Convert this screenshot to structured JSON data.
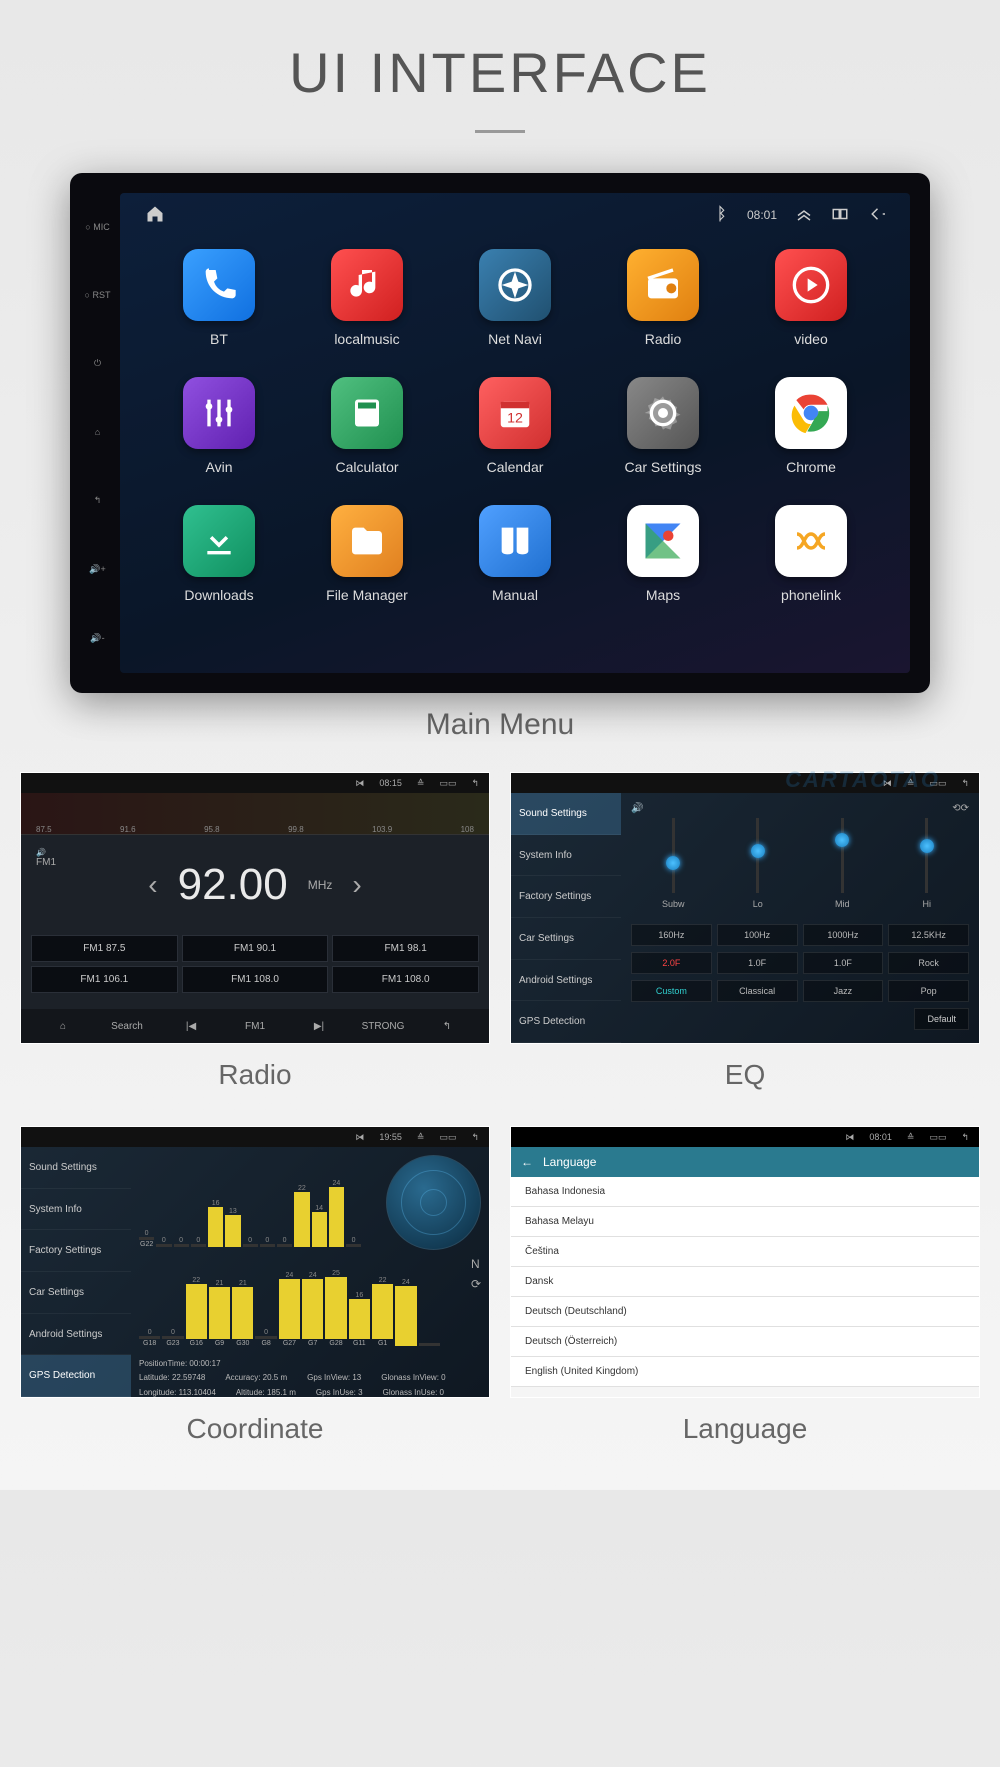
{
  "page": {
    "title": "UI INTERFACE"
  },
  "main": {
    "caption": "Main Menu",
    "status": {
      "time": "08:01"
    },
    "side_labels": {
      "mic": "MIC",
      "rst": "RST"
    },
    "apps": [
      {
        "label": "BT",
        "bg": "linear-gradient(135deg,#3aa0ff,#1070e0)",
        "icon": "phone"
      },
      {
        "label": "localmusic",
        "bg": "linear-gradient(135deg,#ff5050,#d02020)",
        "icon": "music"
      },
      {
        "label": "Net Navi",
        "bg": "linear-gradient(135deg,#3a80b0,#205070)",
        "icon": "compass"
      },
      {
        "label": "Radio",
        "bg": "linear-gradient(135deg,#ffb030,#e08010)",
        "icon": "radio"
      },
      {
        "label": "video",
        "bg": "linear-gradient(135deg,#ff5050,#d02020)",
        "icon": "play"
      },
      {
        "label": "Avin",
        "bg": "linear-gradient(135deg,#9050e0,#6020b0)",
        "icon": "sliders"
      },
      {
        "label": "Calculator",
        "bg": "linear-gradient(135deg,#50c080,#209050)",
        "icon": "calc"
      },
      {
        "label": "Calendar",
        "bg": "linear-gradient(135deg,#ff6060,#d03030)",
        "icon": "calendar"
      },
      {
        "label": "Car Settings",
        "bg": "linear-gradient(135deg,#888,#555)",
        "icon": "gear"
      },
      {
        "label": "Chrome",
        "bg": "#fff",
        "icon": "chrome"
      },
      {
        "label": "Downloads",
        "bg": "linear-gradient(135deg,#30c090,#109060)",
        "icon": "download"
      },
      {
        "label": "File Manager",
        "bg": "linear-gradient(135deg,#ffb040,#e08020)",
        "icon": "folder"
      },
      {
        "label": "Manual",
        "bg": "linear-gradient(135deg,#50a0ff,#2070d0)",
        "icon": "book"
      },
      {
        "label": "Maps",
        "bg": "#fff",
        "icon": "maps"
      },
      {
        "label": "phonelink",
        "bg": "#fff",
        "icon": "link"
      }
    ]
  },
  "radio": {
    "caption": "Radio",
    "status_time": "08:15",
    "band": "FM1",
    "dial": [
      "87.5",
      "91.6",
      "95.8",
      "99.8",
      "103.9",
      "108"
    ],
    "frequency": "92.00",
    "unit": "MHz",
    "presets": [
      "FM1 87.5",
      "FM1 90.1",
      "FM1 98.1",
      "FM1 106.1",
      "FM1 108.0",
      "FM1 108.0"
    ],
    "bottom": {
      "search": "Search",
      "band_btn": "FM1",
      "strong": "STRONG"
    }
  },
  "eq": {
    "caption": "EQ",
    "side": [
      "Sound Settings",
      "System Info",
      "Factory Settings",
      "Car Settings",
      "Android Settings",
      "GPS Detection"
    ],
    "active_side": 0,
    "sliders": [
      {
        "label": "Subw",
        "pos": 50
      },
      {
        "label": "Lo",
        "pos": 35
      },
      {
        "label": "Mid",
        "pos": 20
      },
      {
        "label": "Hi",
        "pos": 28
      }
    ],
    "row1": [
      "160Hz",
      "100Hz",
      "1000Hz",
      "12.5KHz"
    ],
    "row2": [
      "2.0F",
      "1.0F",
      "1.0F",
      "Rock"
    ],
    "row3": [
      "Custom",
      "Classical",
      "Jazz",
      "Pop"
    ],
    "default_btn": "Default"
  },
  "coord": {
    "caption": "Coordinate",
    "status_time": "19:55",
    "side": [
      "Sound Settings",
      "System Info",
      "Factory Settings",
      "Car Settings",
      "Android Settings",
      "GPS Detection"
    ],
    "active_side": 5,
    "sat_nums": [
      "0",
      "0",
      "0",
      "0",
      "16",
      "13",
      "0",
      "0",
      "0",
      "22",
      "14",
      "24",
      "0"
    ],
    "sat_ids": [
      "G22",
      "",
      "",
      "",
      "",
      "",
      "",
      "",
      "",
      "",
      "",
      "",
      ""
    ],
    "sat_nums2": [
      "0",
      "0",
      "22",
      "21",
      "21",
      "0",
      "24",
      "24",
      "25",
      "16",
      "22",
      "24",
      ""
    ],
    "sat_ids2": [
      "G18",
      "G23",
      "G16",
      "G9",
      "G30",
      "G8",
      "G27",
      "G7",
      "G28",
      "G11",
      "G1",
      ""
    ],
    "info": {
      "pos_time_label": "PositionTime:",
      "pos_time": "00:00:17",
      "lat_label": "Latitude:",
      "lat": "22.59748",
      "acc_label": "Accuracy:",
      "acc": "20.5 m",
      "gps_inview_label": "Gps InView:",
      "gps_inview": "13",
      "glo_inview_label": "Glonass InView:",
      "glo_inview": "0",
      "lon_label": "Longitude:",
      "lon": "113.10404",
      "alt_label": "Altitude:",
      "alt": "185.1 m",
      "gps_inuse_label": "Gps InUse:",
      "gps_inuse": "3",
      "glo_inuse_label": "Glonass InUse:",
      "glo_inuse": "0"
    }
  },
  "lang": {
    "caption": "Language",
    "status_time": "08:01",
    "header": "Language",
    "items": [
      "Bahasa Indonesia",
      "Bahasa Melayu",
      "Čeština",
      "Dansk",
      "Deutsch (Deutschland)",
      "Deutsch (Österreich)",
      "English (United Kingdom)"
    ]
  },
  "watermark": "CARTAOTAO"
}
